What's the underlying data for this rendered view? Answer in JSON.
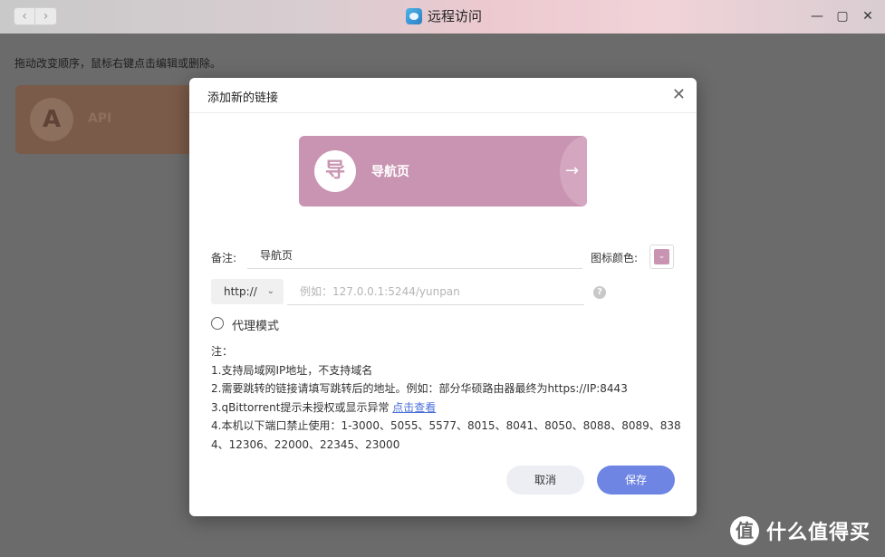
{
  "window": {
    "title": "远程访问",
    "back_glyph": "‹",
    "forward_glyph": "›",
    "min_glyph": "—",
    "max_glyph": "▢",
    "close_glyph": "✕"
  },
  "background": {
    "hint": "拖动改变顺序，鼠标右键点击编辑或删除。",
    "card": {
      "letter": "A",
      "label": "API"
    }
  },
  "dialog": {
    "title": "添加新的链接",
    "close_glyph": "✕",
    "preview": {
      "glyph": "导",
      "label": "导航页",
      "arrow": "→"
    },
    "remark_label": "备注:",
    "remark_value": "导航页",
    "icon_color_label": "图标颜色:",
    "icon_color": "#c994b2",
    "protocol": "http://",
    "url_placeholder": "例如：127.0.0.1:5244/yunpan",
    "help_glyph": "?",
    "proxy_mode_label": "代理模式",
    "notes": {
      "heading": "注：",
      "line1": "1.支持局域网IP地址，不支持域名",
      "line2": "2.需要跳转的链接请填写跳转后的地址。例如：部分华硕路由器最终为https://IP:8443",
      "line3_text": "3.qBittorrent提示未授权或显示异常 ",
      "line3_link": "点击查看",
      "line4": "4.本机以下端口禁止使用：1-3000、5055、5577、8015、8041、8050、8088、8089、838",
      "line5": "4、12306、22000、22345、23000"
    },
    "cancel_label": "取消",
    "save_label": "保存"
  },
  "watermark": {
    "logo": "值",
    "text": "什么值得买"
  }
}
